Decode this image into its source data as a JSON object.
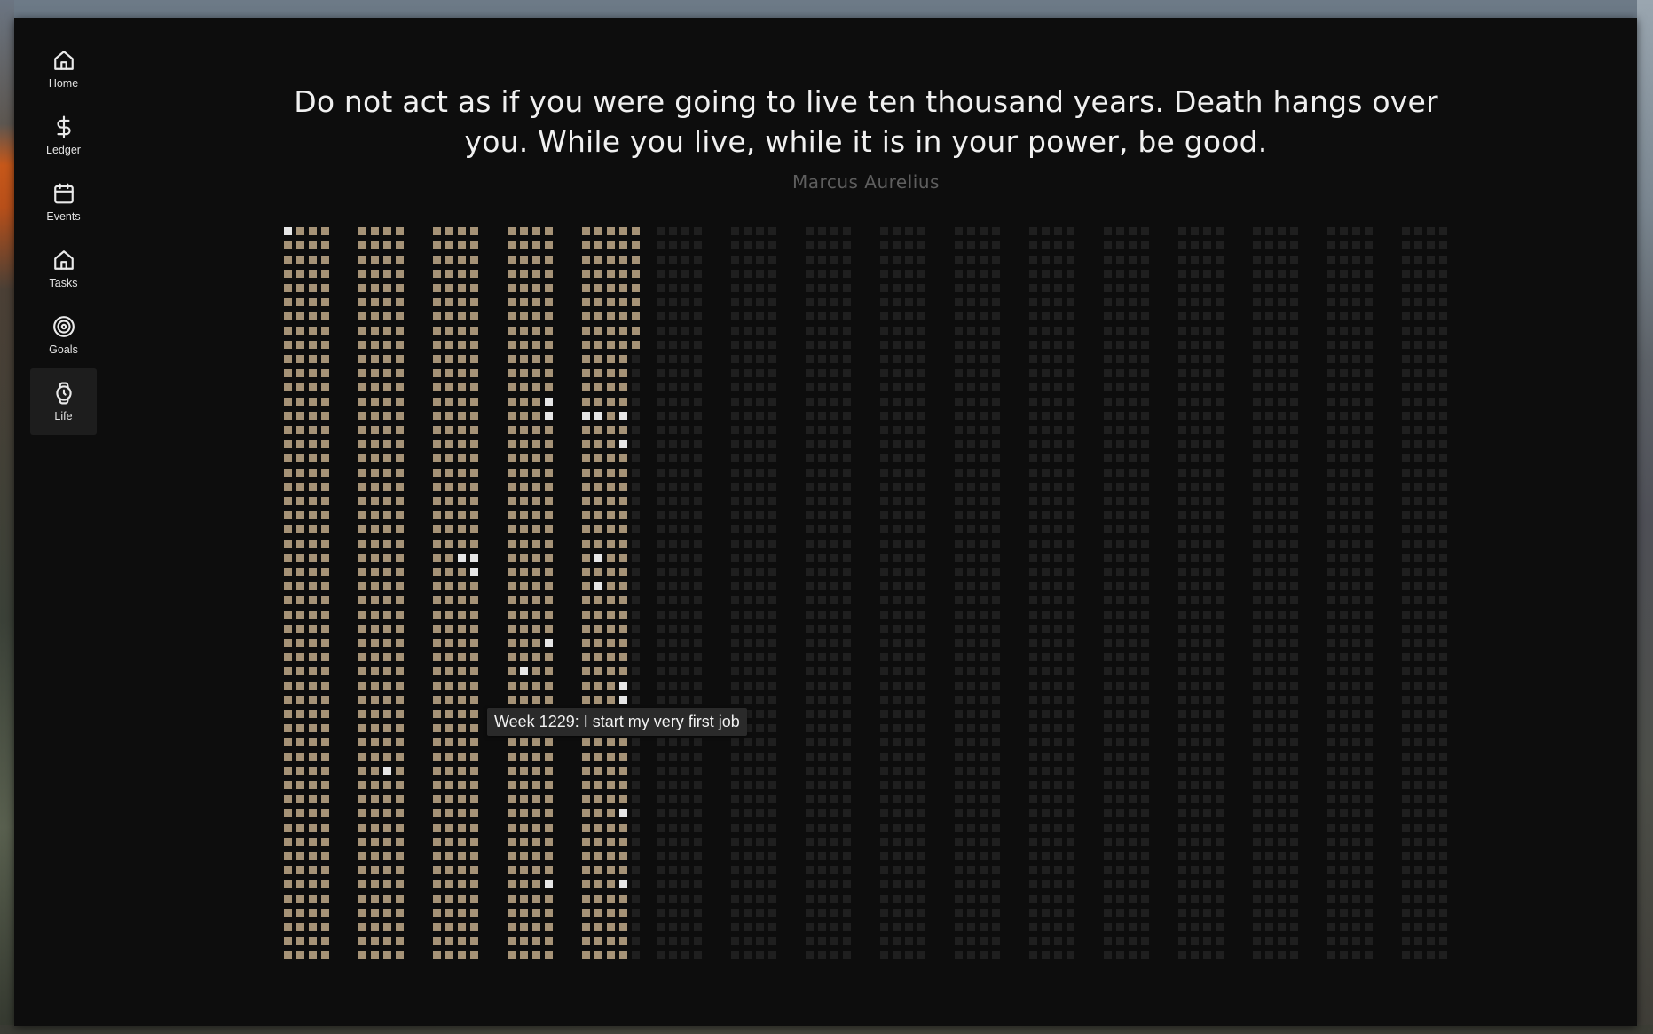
{
  "nav": {
    "items": [
      {
        "label": "Home",
        "icon": "home-icon",
        "active": false
      },
      {
        "label": "Ledger",
        "icon": "dollar-icon",
        "active": false
      },
      {
        "label": "Events",
        "icon": "calendar-icon",
        "active": false
      },
      {
        "label": "Tasks",
        "icon": "home-icon",
        "active": false
      },
      {
        "label": "Goals",
        "icon": "target-icon",
        "active": false
      },
      {
        "label": "Life",
        "icon": "watch-icon",
        "active": true
      }
    ]
  },
  "quote": {
    "text": "Do not act as if you were going to live ten thousand years. Death hangs over you. While you live, while it is in your power, be good.",
    "author": "Marcus Aurelius"
  },
  "life_grid": {
    "total_years": 16,
    "weeks_per_year": 52,
    "colors": {
      "lived": "#a59276",
      "future": "#1f1f1f",
      "event": "#e6e6e6",
      "current": "#e6e6e6"
    },
    "current_week": {
      "year": 0,
      "week": 0
    },
    "tooltip": "Week 1229: I start my very first job"
  }
}
